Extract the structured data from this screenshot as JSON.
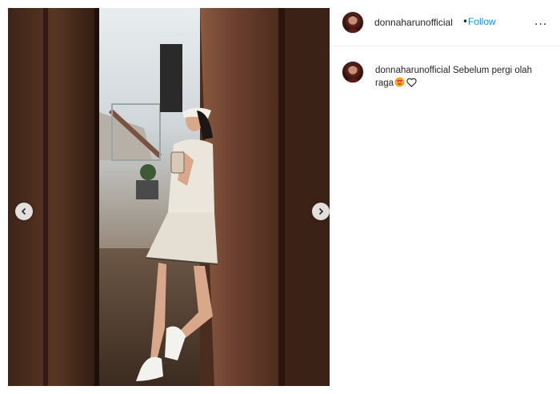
{
  "post": {
    "media": {
      "alt": "Mirror selfie in a wood-paneled hallway",
      "prev_icon": "chevron-left-icon",
      "next_icon": "chevron-right-icon"
    },
    "header": {
      "username": "donnaharunofficial",
      "separator": "•",
      "follow_label": "Follow",
      "more_icon": "more-options-icon",
      "more_label": "..."
    },
    "caption": {
      "username": "donnaharunofficial",
      "text": "Sebelum pergi olah raga",
      "emoji_icon": "heart-eyes-emoji-icon",
      "like_icon": "heart-outline-icon"
    },
    "colors": {
      "link": "#0095f6",
      "text": "#262626",
      "divider": "#efefef"
    }
  }
}
